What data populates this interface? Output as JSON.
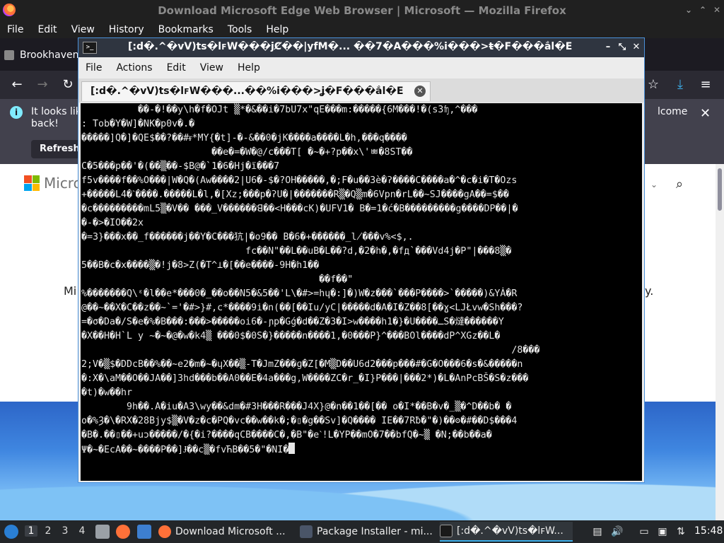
{
  "firefox": {
    "window_title": "Download Microsoft Edge Web Browser | Microsoft — Mozilla Firefox",
    "menu": [
      "File",
      "Edit",
      "View",
      "History",
      "Bookmarks",
      "Tools",
      "Help"
    ],
    "tab_label": "Brookhaven",
    "info_bar": {
      "text_left": "It looks lik",
      "text_left_2": "back!",
      "text_right": "lcome",
      "refresh_label": "Refresh"
    },
    "page": {
      "brand": "Micro",
      "body_left": "Mi",
      "body_right": "y."
    }
  },
  "terminal": {
    "title": "[:d�.^�vV)ts�lꜰW���jȻ��|yfM�... ��7�A���%i̇���>ŧ�F���ắl�E",
    "menu": [
      "File",
      "Actions",
      "Edit",
      "View",
      "Help"
    ],
    "tab_title": "[:d�.^�vV)ts�lꜰW���...��%i̇���>ʝ�F���ắl�E",
    "lines": [
      "          ��-�!��y\\h�f�OJt ▒*�&��i�7bU7x\"qE���m:�����{6M���!�(s3ʩ,^���",
      ": Tob�Y�W]�NK�p0v�.�",
      "�����]Q�]�QE$��?��#ᵲ*MY{�t]-�-&��0�jK����a����L�h,���q����",
      "                       ��e�=�W�@/c���T[ �~�+?p��x\\'ㅃ�8ST��",
      "C�5���p��'�(��▒��-$B@�`1�6�Hj�ï���7",
      "f5v����f��%O���|W�Q�(Aw����2|U6�-$�?OH�����,�;F�u��3è�ʔ����C����a�^�c�i�T�Ozs",
      "+�����L4�ˋ����.�����L�l,�[Xz;���p�ʔU�|�������R▒�Q▒m�6Vpn�rL��~SJ����gA��=$��",
      "�c���������mL5▒�V�� ���_V������ꓭ��<H���cK)�UFV1� B�=1�ć�B���������g����DP��|�",
      "�-�>�IO��2x",
      "�=3}���x��_f������j��Y�C���犺|�o9�� B�6�+������_l̸���v%<$,.",
      "                             fc��N\"��L��uB�L��?d,�2�h�,�fд`���Vd4j�P\"|���8▒�",
      "5��B�c�x����▒�!j�8>Z(�T^⊥�[��e����-9H�h1��",
      "                                          ��f��\"",
      "%�������Q\\ᵋ�l��e*���0�_��o��N5�&5��'L\\�#>=hɥ�:]�)W�z���`���P����>`�����)&YȦ�R",
      "@��~��X�C��z��~`='�#>}#,c*����9i�n(��[��Iu/yC|�����d�A�I�Z��8[��ɣ<LJŁvw�Sh���?",
      "=�σ�Da�/S�e�%�B���:���>�����oi6�-ɲp�Gǵ�d��Z�3�I>w����h1�}�U����ـS�燵������Y",
      "�X��H�H`L y ~�~�@�w�k4▒ ���0$�0S�}�����n����1,�0���P}^���BOl����dP^XGz��L�",
      "                                                                            /8���",
      "2;V�▒$�DDcB��%��~e2�m�~�ɥX��▒-T�JmZ���ɡ�Z[�M▒D��U6d2���p���#�G�O���6�s�&�����n",
      "�:X�\\aM��O��JA��]3hd���b��A0��E�4a���g,W����ZC�r_�I}P���|���2*)�L�AnPcBŠ�S�z���",
      "�t)�w��hr",
      "        9h��.A�iu�A3\\wy��&dm�#3H���R���J4X}@�n��1��[�� o�I*��B�v�_▒�^D��b� �",
      "o�%Ȝ�\\�RX�28Bjy$▒�V�z�c�PQ�vc��w��k�;�▯�g��Sv]�Q���� IE��7Rƀ�\"�)��ʘ�#��D$���4",
      "�B�.��▯��+uɔ�����/�{�i?����qCB����C�,�B\"�eˋ!L�YP��mO�7��bfQ�~▒ �N;��b��a�",
      "Ψ�~�EcA��~����P��]Ɉ��c▒�fvЋB��5�\"�NI�"
    ]
  },
  "taskbar": {
    "workspaces": [
      "1",
      "2",
      "3",
      "4"
    ],
    "tasks": [
      {
        "label": "Download Microsoft ..."
      },
      {
        "label": "Package Installer - mi..."
      },
      {
        "label": "[:d�.^�vV)ts�lꜰW..."
      }
    ],
    "clock": "15:48"
  },
  "colors": {
    "terminal_bg": "#000000",
    "terminal_fg": "#e6e6e6",
    "titlebar": "#2f3540",
    "accent": "#3daee9"
  }
}
